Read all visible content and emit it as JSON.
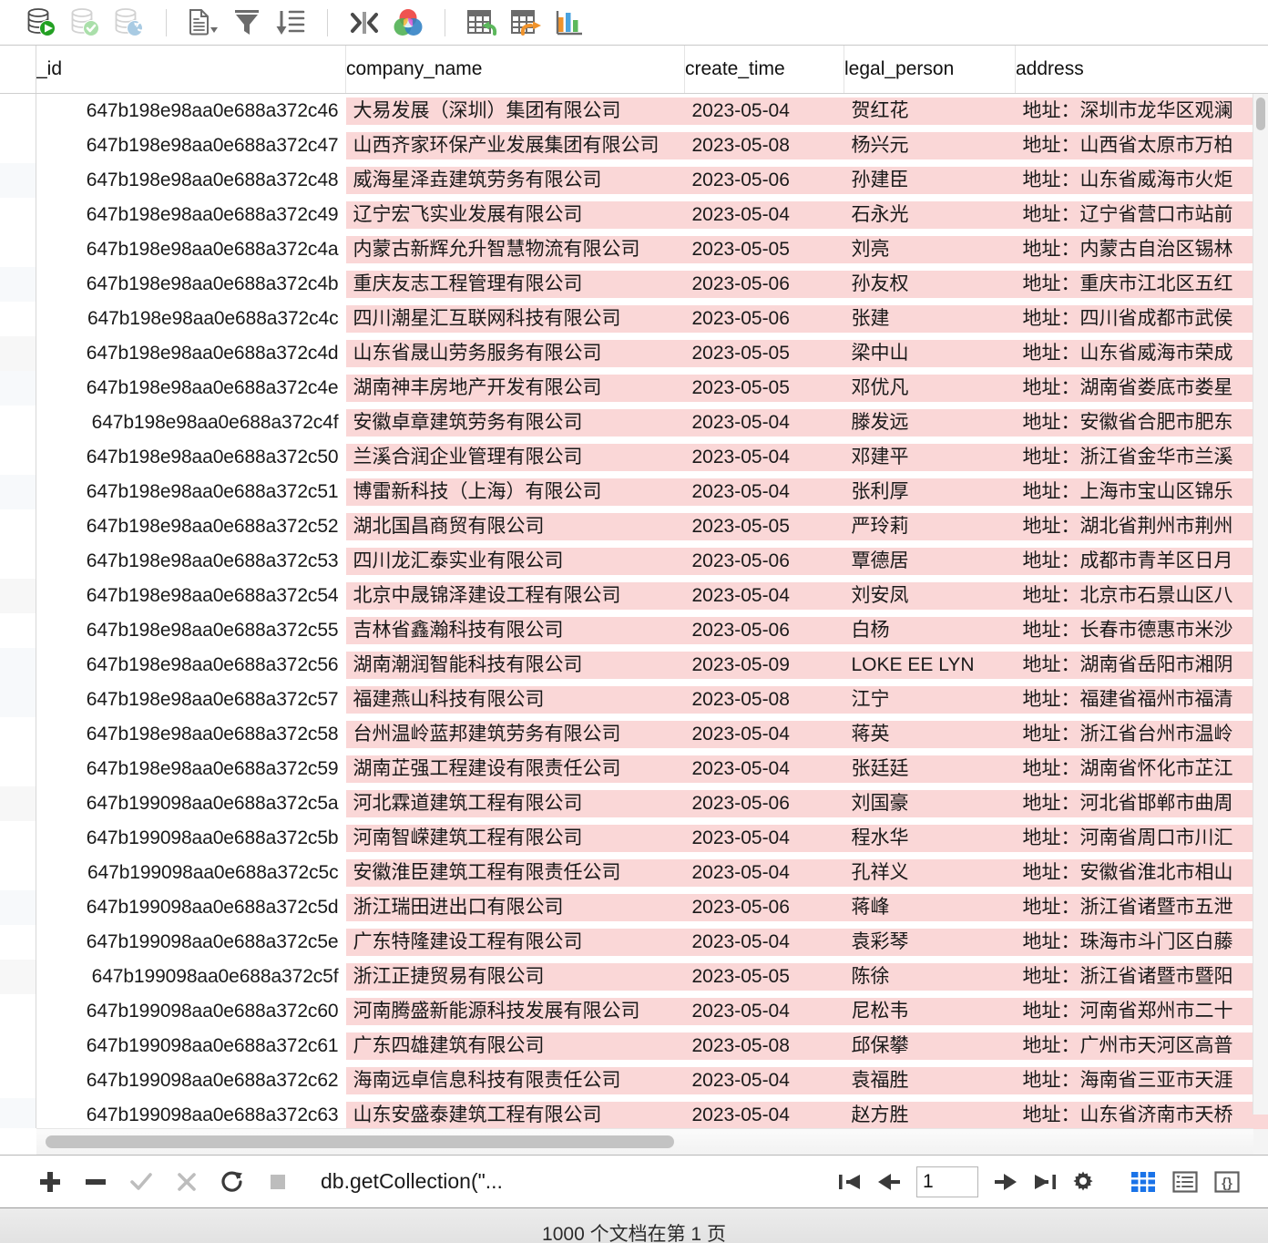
{
  "toolbar": {
    "groups": [
      {
        "buttons": [
          {
            "name": "execute-sql-icon",
            "label": "Execute"
          },
          {
            "name": "commit-icon",
            "label": "Commit"
          },
          {
            "name": "rollback-icon",
            "label": "Rollback"
          }
        ]
      },
      {
        "buttons": [
          {
            "name": "document-dropdown-icon",
            "label": "Document"
          },
          {
            "name": "filter-icon",
            "label": "Filter"
          },
          {
            "name": "sort-descending-icon",
            "label": "Sort"
          }
        ]
      },
      {
        "buttons": [
          {
            "name": "collapse-columns-icon",
            "label": "Fit Columns"
          },
          {
            "name": "color-venn-icon",
            "label": "Color Scheme"
          }
        ]
      },
      {
        "buttons": [
          {
            "name": "import-table-icon",
            "label": "Import"
          },
          {
            "name": "export-table-icon",
            "label": "Export"
          },
          {
            "name": "chart-icon",
            "label": "Chart"
          }
        ]
      }
    ]
  },
  "grid": {
    "columns": [
      {
        "key": "_id",
        "label": "_id"
      },
      {
        "key": "company_name",
        "label": "company_name"
      },
      {
        "key": "create_time",
        "label": "create_time"
      },
      {
        "key": "legal_person",
        "label": "legal_person"
      },
      {
        "key": "address",
        "label": "address"
      }
    ],
    "rows": [
      {
        "_id": "647b198e98aa0e688a372c46",
        "company_name": "大易发展（深圳）集团有限公司",
        "create_time": "2023-05-04",
        "legal_person": "贺红花",
        "address": "地址：深圳市龙华区观澜"
      },
      {
        "_id": "647b198e98aa0e688a372c47",
        "company_name": "山西齐家环保产业发展集团有限公司",
        "create_time": "2023-05-08",
        "legal_person": "杨兴元",
        "address": "地址：山西省太原市万柏"
      },
      {
        "_id": "647b198e98aa0e688a372c48",
        "company_name": "威海星泽垚建筑劳务有限公司",
        "create_time": "2023-05-06",
        "legal_person": "孙建臣",
        "address": "地址：山东省威海市火炬"
      },
      {
        "_id": "647b198e98aa0e688a372c49",
        "company_name": "辽宁宏飞实业发展有限公司",
        "create_time": "2023-05-04",
        "legal_person": "石永光",
        "address": "地址：辽宁省营口市站前"
      },
      {
        "_id": "647b198e98aa0e688a372c4a",
        "company_name": "内蒙古新辉允升智慧物流有限公司",
        "create_time": "2023-05-05",
        "legal_person": "刘亮",
        "address": "地址：内蒙古自治区锡林"
      },
      {
        "_id": "647b198e98aa0e688a372c4b",
        "company_name": "重庆友志工程管理有限公司",
        "create_time": "2023-05-06",
        "legal_person": "孙友权",
        "address": "地址：重庆市江北区五红"
      },
      {
        "_id": "647b198e98aa0e688a372c4c",
        "company_name": "四川潮星汇互联网科技有限公司",
        "create_time": "2023-05-06",
        "legal_person": "张建",
        "address": "地址：四川省成都市武侯"
      },
      {
        "_id": "647b198e98aa0e688a372c4d",
        "company_name": "山东省晟山劳务服务有限公司",
        "create_time": "2023-05-05",
        "legal_person": "梁中山",
        "address": "地址：山东省威海市荣成"
      },
      {
        "_id": "647b198e98aa0e688a372c4e",
        "company_name": "湖南神丰房地产开发有限公司",
        "create_time": "2023-05-05",
        "legal_person": "邓优凡",
        "address": "地址：湖南省娄底市娄星"
      },
      {
        "_id": "647b198e98aa0e688a372c4f",
        "company_name": "安徽卓章建筑劳务有限公司",
        "create_time": "2023-05-04",
        "legal_person": "滕发远",
        "address": "地址：安徽省合肥市肥东"
      },
      {
        "_id": "647b198e98aa0e688a372c50",
        "company_name": "兰溪合润企业管理有限公司",
        "create_time": "2023-05-04",
        "legal_person": "邓建平",
        "address": "地址：浙江省金华市兰溪"
      },
      {
        "_id": "647b198e98aa0e688a372c51",
        "company_name": "博雷新科技（上海）有限公司",
        "create_time": "2023-05-04",
        "legal_person": "张利厚",
        "address": "地址：上海市宝山区锦乐"
      },
      {
        "_id": "647b198e98aa0e688a372c52",
        "company_name": "湖北国昌商贸有限公司",
        "create_time": "2023-05-05",
        "legal_person": "严玲莉",
        "address": "地址：湖北省荆州市荆州"
      },
      {
        "_id": "647b198e98aa0e688a372c53",
        "company_name": "四川龙汇泰实业有限公司",
        "create_time": "2023-05-06",
        "legal_person": "覃德居",
        "address": "地址：成都市青羊区日月"
      },
      {
        "_id": "647b198e98aa0e688a372c54",
        "company_name": "北京中晟锦泽建设工程有限公司",
        "create_time": "2023-05-04",
        "legal_person": "刘安凤",
        "address": "地址：北京市石景山区八"
      },
      {
        "_id": "647b198e98aa0e688a372c55",
        "company_name": "吉林省鑫瀚科技有限公司",
        "create_time": "2023-05-06",
        "legal_person": "白杨",
        "address": "地址：长春市德惠市米沙"
      },
      {
        "_id": "647b198e98aa0e688a372c56",
        "company_name": "湖南潮润智能科技有限公司",
        "create_time": "2023-05-09",
        "legal_person": "LOKE EE LYN",
        "address": "地址：湖南省岳阳市湘阴"
      },
      {
        "_id": "647b198e98aa0e688a372c57",
        "company_name": "福建燕山科技有限公司",
        "create_time": "2023-05-08",
        "legal_person": "江宁",
        "address": "地址：福建省福州市福清"
      },
      {
        "_id": "647b198e98aa0e688a372c58",
        "company_name": "台州温岭蓝邦建筑劳务有限公司",
        "create_time": "2023-05-04",
        "legal_person": "蒋英",
        "address": "地址：浙江省台州市温岭"
      },
      {
        "_id": "647b198e98aa0e688a372c59",
        "company_name": "湖南芷强工程建设有限责任公司",
        "create_time": "2023-05-04",
        "legal_person": "张廷廷",
        "address": "地址：湖南省怀化市芷江"
      },
      {
        "_id": "647b199098aa0e688a372c5a",
        "company_name": "河北霖道建筑工程有限公司",
        "create_time": "2023-05-06",
        "legal_person": "刘国豪",
        "address": "地址：河北省邯郸市曲周"
      },
      {
        "_id": "647b199098aa0e688a372c5b",
        "company_name": "河南智嵘建筑工程有限公司",
        "create_time": "2023-05-04",
        "legal_person": "程水华",
        "address": "地址：河南省周口市川汇"
      },
      {
        "_id": "647b199098aa0e688a372c5c",
        "company_name": "安徽淮臣建筑工程有限责任公司",
        "create_time": "2023-05-04",
        "legal_person": "孔祥义",
        "address": "地址：安徽省淮北市相山"
      },
      {
        "_id": "647b199098aa0e688a372c5d",
        "company_name": "浙江瑞田进出口有限公司",
        "create_time": "2023-05-06",
        "legal_person": "蒋峰",
        "address": "地址：浙江省诸暨市五泄"
      },
      {
        "_id": "647b199098aa0e688a372c5e",
        "company_name": "广东特隆建设工程有限公司",
        "create_time": "2023-05-04",
        "legal_person": "袁彩琴",
        "address": "地址：珠海市斗门区白藤"
      },
      {
        "_id": "647b199098aa0e688a372c5f",
        "company_name": "浙江正捷贸易有限公司",
        "create_time": "2023-05-05",
        "legal_person": "陈徐",
        "address": "地址：浙江省诸暨市暨阳"
      },
      {
        "_id": "647b199098aa0e688a372c60",
        "company_name": "河南腾盛新能源科技发展有限公司",
        "create_time": "2023-05-04",
        "legal_person": "尼松韦",
        "address": "地址：河南省郑州市二十"
      },
      {
        "_id": "647b199098aa0e688a372c61",
        "company_name": "广东四雄建筑有限公司",
        "create_time": "2023-05-08",
        "legal_person": "邱保攀",
        "address": "地址：广州市天河区高普"
      },
      {
        "_id": "647b199098aa0e688a372c62",
        "company_name": "海南远卓信息科技有限责任公司",
        "create_time": "2023-05-04",
        "legal_person": "袁福胜",
        "address": "地址：海南省三亚市天涯"
      },
      {
        "_id": "647b199098aa0e688a372c63",
        "company_name": "山东安盛泰建筑工程有限公司",
        "create_time": "2023-05-04",
        "legal_person": "赵方胜",
        "address": "地址：山东省济南市天桥"
      }
    ]
  },
  "bottombar": {
    "actions": [
      {
        "name": "add-row-button",
        "label": "+"
      },
      {
        "name": "delete-row-button",
        "label": "−"
      },
      {
        "name": "confirm-button",
        "label": "✓"
      },
      {
        "name": "cancel-button",
        "label": "✕"
      },
      {
        "name": "refresh-button",
        "label": "↻"
      },
      {
        "name": "stop-button",
        "label": "■"
      }
    ],
    "query": "db.getCollection(\"...",
    "pagination": {
      "first_label": "|←",
      "prev_label": "←",
      "page_value": "1",
      "page_placeholder": "1",
      "next_label": "→",
      "last_label": "→|",
      "settings_label": "Settings"
    },
    "view_modes": [
      {
        "name": "grid-view-icon",
        "label": "Grid",
        "active": true,
        "color": "#1a73e8"
      },
      {
        "name": "tree-view-icon",
        "label": "Tree",
        "active": false,
        "color": "#606060"
      },
      {
        "name": "json-view-icon",
        "label": "JSON",
        "active": false,
        "color": "#606060"
      }
    ]
  },
  "statusbar": {
    "text": "1000 个文档在第 1 页"
  },
  "colors": {
    "highlight_cell": "#fad7d7",
    "accent": "#1a73e8",
    "toolbar_icon": "#6b6b6b",
    "execute_green": "#2aa02a",
    "commit_green": "#a8dba8",
    "rollback_blue": "#a8c9e0",
    "import_green": "#5cb85c",
    "export_orange": "#f0932b"
  }
}
